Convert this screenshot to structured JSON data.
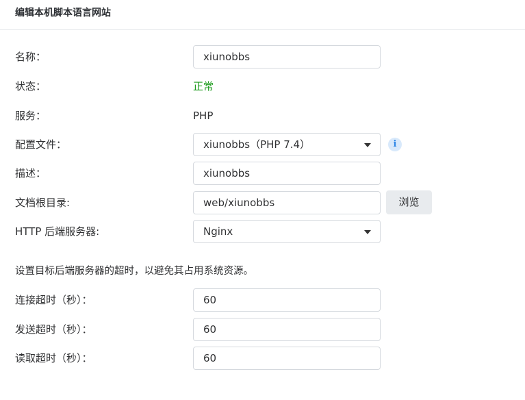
{
  "header": {
    "title": "编辑本机脚本语言网站"
  },
  "form": {
    "name": {
      "label": "名称：",
      "value": "xiunobbs"
    },
    "status": {
      "label": "状态：",
      "value": "正常",
      "color": "#1a9a1a"
    },
    "service": {
      "label": "服务：",
      "value": "PHP"
    },
    "profile": {
      "label": "配置文件：",
      "value": "xiunobbs（PHP 7.4）",
      "info_icon": "info-icon"
    },
    "description": {
      "label": "描述：",
      "value": "xiunobbs"
    },
    "docroot": {
      "label": "文档根目录:",
      "value": "web/xiunobbs",
      "browse_label": "浏览"
    },
    "backend": {
      "label": "HTTP 后端服务器:",
      "value": "Nginx"
    }
  },
  "timeouts": {
    "description": "设置目标后端服务器的超时，以避免其占用系统资源。",
    "connect": {
      "label": "连接超时（秒）：",
      "value": "60"
    },
    "send": {
      "label": "发送超时（秒）：",
      "value": "60"
    },
    "read": {
      "label": "读取超时（秒）：",
      "value": "60"
    }
  }
}
